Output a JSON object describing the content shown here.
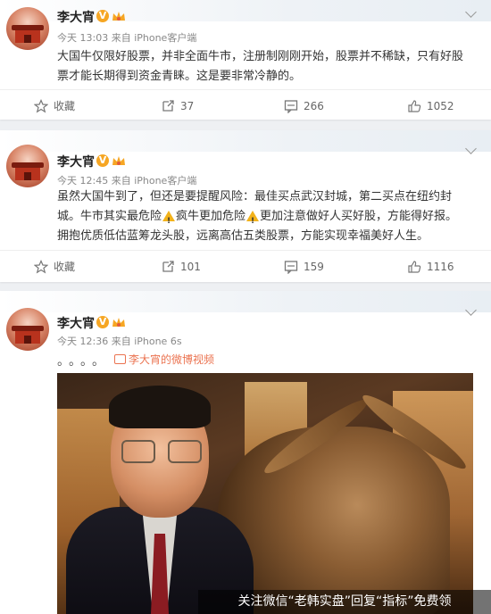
{
  "posts": [
    {
      "author": "李大宵",
      "meta": "今天 13:03 来自 iPhone客户端",
      "text_lines": [
        "大国牛仅限好股票，并非全面牛市，注册制刚刚开始，股票并不稀缺，只有好股",
        "票才能长期得到资金青睐。这是要非常冷静的。"
      ],
      "actions": {
        "fav": "收藏",
        "repost": "37",
        "comment": "266",
        "like": "1052"
      }
    },
    {
      "author": "李大宵",
      "meta": "今天 12:45 来自 iPhone客户端",
      "text_lines": [
        "虽然大国牛到了，但还是要提醒风险：最佳买点武汉封城，第二买点在纽约封",
        "城。牛市其实最危险",
        "疯牛更加危险",
        "更加注意做好人买好股，方能得好报。",
        "拥抱优质低估蓝筹龙头股，远离高估五类股票，方能实现幸福美好人生。"
      ],
      "actions": {
        "fav": "收藏",
        "repost": "101",
        "comment": "159",
        "like": "1116"
      }
    },
    {
      "author": "李大宵",
      "meta": "今天 12:36 来自 iPhone 6s",
      "dots": "。。。。",
      "video_link": "李大宵的微博视频"
    }
  ],
  "watermark": "关注微信“老韩实盘”回复“指标”免费领",
  "icons": {
    "verified": "v-badge-icon",
    "crown": "crown-icon",
    "menu": "chevron-down-icon",
    "fav": "star-icon",
    "repost": "repost-icon",
    "comment": "comment-icon",
    "like": "thumbs-up-icon",
    "warning": "warning-icon",
    "video": "video-icon"
  },
  "colors": {
    "link": "#eb7350",
    "badge": "#f6a623"
  }
}
